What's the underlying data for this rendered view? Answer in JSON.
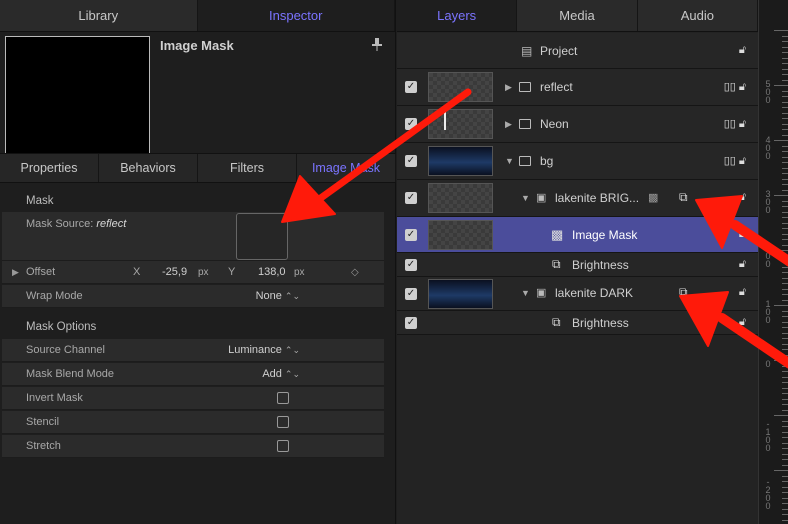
{
  "left_tabs": [
    "Library",
    "Inspector"
  ],
  "right_tabs": [
    "Layers",
    "Media",
    "Audio"
  ],
  "inspector": {
    "title": "Image Mask",
    "subtabs": [
      "Properties",
      "Behaviors",
      "Filters",
      "Image Mask"
    ],
    "mask_section": "Mask",
    "mask_source_label": "Mask Source:",
    "mask_source_value": "reflect",
    "offset_label": "Offset",
    "offset_x_label": "X",
    "offset_x_value": "-25,9",
    "offset_y_label": "Y",
    "offset_y_value": "138,0",
    "unit": "px",
    "wrap_mode_label": "Wrap Mode",
    "wrap_mode_value": "None",
    "options_section": "Mask Options",
    "source_channel_label": "Source Channel",
    "source_channel_value": "Luminance",
    "blend_mode_label": "Mask Blend Mode",
    "blend_mode_value": "Add",
    "invert_label": "Invert Mask",
    "stencil_label": "Stencil",
    "stretch_label": "Stretch"
  },
  "layers": {
    "project": "Project",
    "reflect": "reflect",
    "neon": "Neon",
    "bg": "bg",
    "lakenite_bright": "lakenite BRIG...",
    "image_mask": "Image Mask",
    "brightness_1": "Brightness",
    "lakenite_dark": "lakenite DARK",
    "brightness_2": "Brightness"
  },
  "ruler_labels": [
    "500",
    "400",
    "300",
    "200",
    "100",
    "0",
    "-100",
    "-200"
  ],
  "accent_color": "#7b74ff",
  "selection_color": "#4b4d9b",
  "annotation_color": "#ff1a0a"
}
